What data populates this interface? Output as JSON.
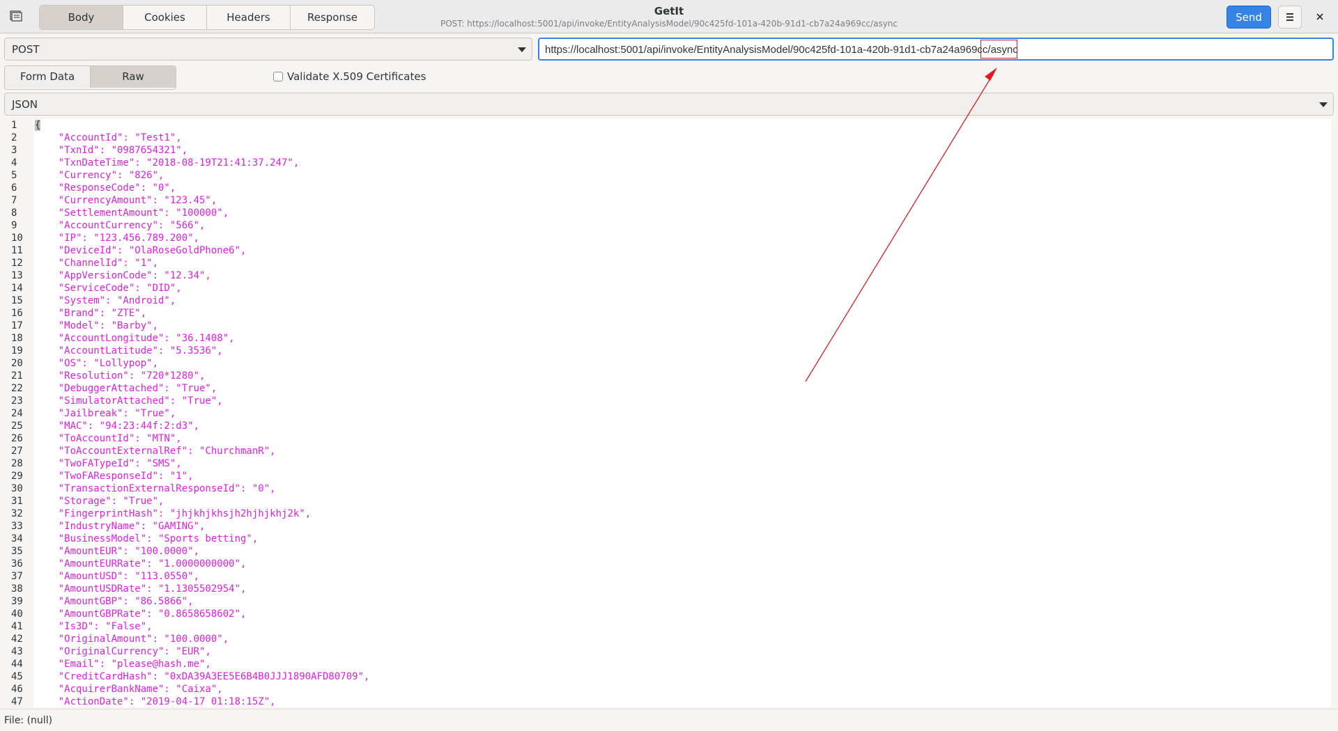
{
  "header": {
    "tabs": [
      "Body",
      "Cookies",
      "Headers",
      "Response"
    ],
    "active_tab": "Body",
    "title": "GetIt",
    "subtitle": "POST: https://localhost:5001/api/invoke/EntityAnalysisModel/90c425fd-101a-420b-91d1-cb7a24a969cc/async",
    "send_label": "Send"
  },
  "request": {
    "method": "POST",
    "url_main": "https://localhost:5001/api/invoke/EntityAnalysisModel/90c425fd-101a-420b-91d1-cb7a24a969c",
    "url_highlight": "c/async"
  },
  "body_type": {
    "options": [
      "Form Data",
      "Raw"
    ],
    "active": "Raw",
    "validate_label": "Validate X.509 Certificates",
    "validate_checked": false,
    "format": "JSON"
  },
  "editor": {
    "lines": [
      "{",
      "    \"AccountId\": \"Test1\",",
      "    \"TxnId\": \"0987654321\",",
      "    \"TxnDateTime\": \"2018-08-19T21:41:37.247\",",
      "    \"Currency\": \"826\",",
      "    \"ResponseCode\": \"0\",",
      "    \"CurrencyAmount\": \"123.45\",",
      "    \"SettlementAmount\": \"100000\",",
      "    \"AccountCurrency\": \"566\",",
      "    \"IP\": \"123.456.789.200\",",
      "    \"DeviceId\": \"OlaRoseGoldPhone6\",",
      "    \"ChannelId\": \"1\",",
      "    \"AppVersionCode\": \"12.34\",",
      "    \"ServiceCode\": \"DID\",",
      "    \"System\": \"Android\",",
      "    \"Brand\": \"ZTE\",",
      "    \"Model\": \"Barby\",",
      "    \"AccountLongitude\": \"36.1408\",",
      "    \"AccountLatitude\": \"5.3536\",",
      "    \"OS\": \"Lollypop\",",
      "    \"Resolution\": \"720*1280\",",
      "    \"DebuggerAttached\": \"True\",",
      "    \"SimulatorAttached\": \"True\",",
      "    \"Jailbreak\": \"True\",",
      "    \"MAC\": \"94:23:44f:2:d3\",",
      "    \"ToAccountId\": \"MTN\",",
      "    \"ToAccountExternalRef\": \"ChurchmanR\",",
      "    \"TwoFATypeId\": \"SMS\",",
      "    \"TwoFAResponseId\": \"1\",",
      "    \"TransactionExternalResponseId\": \"0\",",
      "    \"Storage\": \"True\",",
      "    \"FingerprintHash\": \"jhjkhjkhsjh2hjhjkhj2k\",",
      "    \"IndustryName\": \"GAMING\",",
      "    \"BusinessModel\": \"Sports betting\",",
      "    \"AmountEUR\": \"100.0000\",",
      "    \"AmountEURRate\": \"1.0000000000\",",
      "    \"AmountUSD\": \"113.0550\",",
      "    \"AmountUSDRate\": \"1.1305502954\",",
      "    \"AmountGBP\": \"86.5866\",",
      "    \"AmountGBPRate\": \"0.8658658602\",",
      "    \"Is3D\": \"False\",",
      "    \"OriginalAmount\": \"100.0000\",",
      "    \"OriginalCurrency\": \"EUR\",",
      "    \"Email\": \"please@hash.me\",",
      "    \"CreditCardHash\": \"0xDA39A3EE5E6B4B0JJJ1890AFD80709\",",
      "    \"AcquirerBankName\": \"Caixa\",",
      "    \"ActionDate\": \"2019-04-17 01:18:15Z\","
    ]
  },
  "status": {
    "text": "File: (null)"
  },
  "colors": {
    "accent": "#3584e4",
    "json_string": "#e020e0",
    "annotation": "#e01b24"
  },
  "icons": {
    "app": "notebook-icon",
    "menu": "hamburger-icon",
    "close": "close-icon",
    "dropdown": "chevron-down-icon"
  }
}
